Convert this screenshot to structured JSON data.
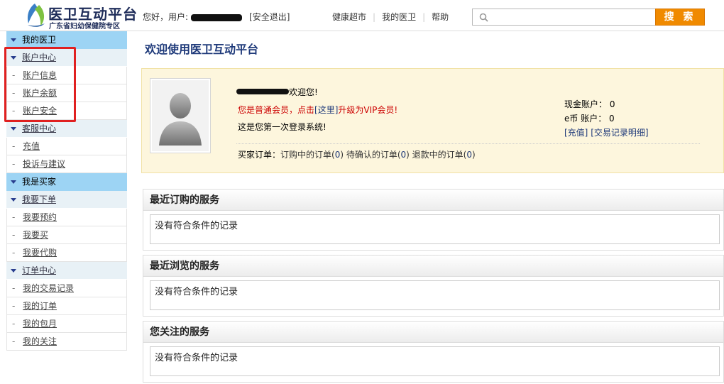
{
  "header": {
    "logo_title": "医卫互动平台",
    "logo_subtitle": "广东省妇幼保健院专区",
    "greeting_prefix": "您好，用户:",
    "logout": "[安全退出]",
    "nav": [
      "健康超市",
      "我的医卫",
      "帮助"
    ],
    "search_placeholder": "",
    "search_button": "搜 索"
  },
  "sidebar": {
    "section1": "我的医卫",
    "group_account": "账户中心",
    "account_items": [
      "账户信息",
      "账户余额",
      "账户安全"
    ],
    "group_service": "客服中心",
    "service_items": [
      "充值",
      "投诉与建议"
    ],
    "section2": "我是买家",
    "group_buy": "我要下单",
    "buy_items": [
      "我要预约",
      "我要买",
      "我要代购"
    ],
    "group_order": "订单中心",
    "order_items": [
      "我的交易记录",
      "我的订单",
      "我的包月",
      "我的关注"
    ]
  },
  "main": {
    "welcome_title": "欢迎使用医卫互动平台",
    "user_welcome": "欢迎您!",
    "vip_prefix": "您是普通会员，点击",
    "vip_link": "[这里]",
    "vip_suffix": "升级为VIP会员!",
    "first_login": "这是您第一次登录系统!",
    "orders_label": "买家订单：",
    "orders_text1": "订购中的订单(",
    "orders_n1": "0",
    "orders_text2": ") 待确认的订单(",
    "orders_n2": "0",
    "orders_text3": ") 退款中的订单(",
    "orders_n3": "0",
    "orders_text4": ")",
    "cash_label": "现金账户：",
    "cash_value": "0",
    "ecoin_label": "e币 账户：",
    "ecoin_value": "0",
    "recharge_link": "[充值]",
    "records_link": "[交易记录明细]",
    "panels": [
      {
        "title": "最近订购的服务",
        "empty": "没有符合条件的记录"
      },
      {
        "title": "最近浏览的服务",
        "empty": "没有符合条件的记录"
      },
      {
        "title": "您关注的服务",
        "empty": "没有符合条件的记录"
      }
    ]
  },
  "colors": {
    "sidebar_header": "#9dd4f4",
    "search_button": "#f08a00",
    "highlight_box": "#e02020",
    "title_blue": "#1f3a7a"
  }
}
